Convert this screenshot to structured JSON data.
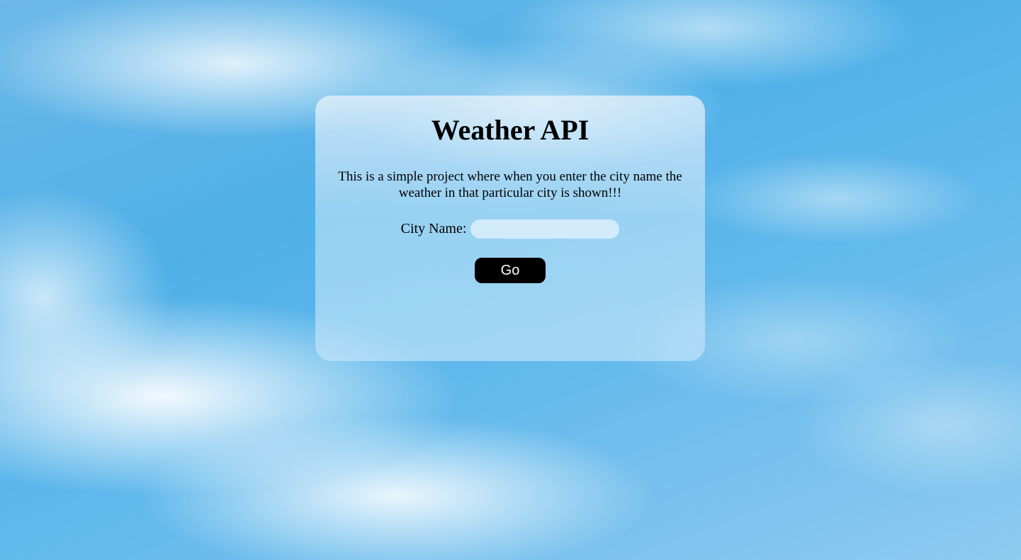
{
  "card": {
    "title": "Weather API",
    "description": "This is a simple project where when you enter the city name the weather in that particular city is shown!!!",
    "city_label": "City Name:",
    "city_input_value": "",
    "city_input_placeholder": "",
    "go_label": "Go"
  },
  "colors": {
    "button_background": "#000000",
    "button_text": "#ffffff",
    "sky_blue": "#4fb0e8"
  }
}
